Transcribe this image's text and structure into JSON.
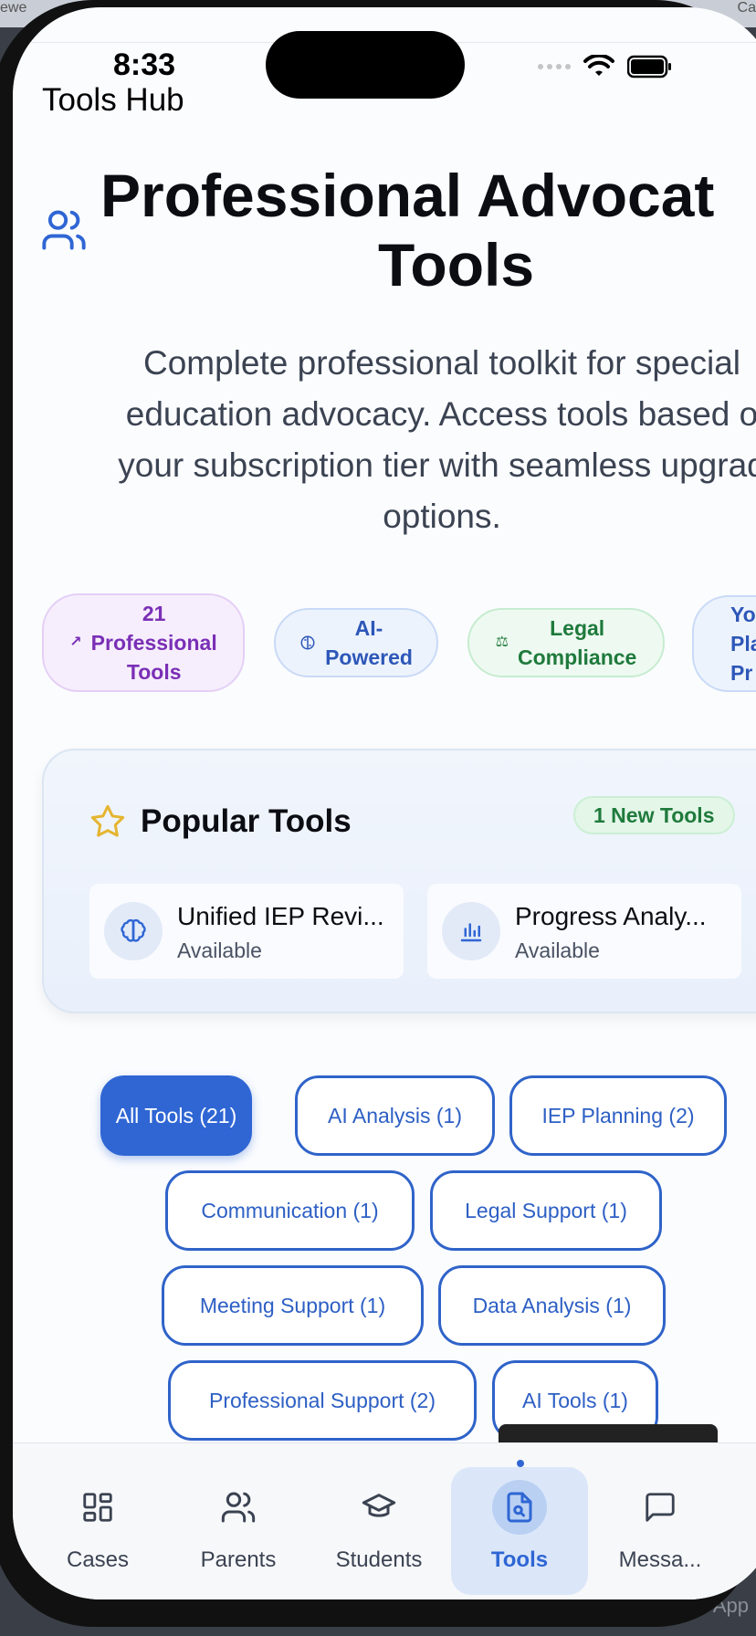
{
  "desktop": {
    "left_text": "ewe",
    "right_text": "Ca",
    "bottom_text": "App"
  },
  "status_bar": {
    "time": "8:33"
  },
  "app": {
    "title": "Tools Hub"
  },
  "hero": {
    "heading_line1": "Professional Advocat",
    "heading_line2": "Tools",
    "subtitle_lines": [
      "Complete professional toolkit for special",
      "education advocacy. Access tools based o",
      "your subscription tier with seamless upgrad",
      "options."
    ]
  },
  "badges": [
    {
      "lines": [
        "21",
        "Professional",
        "Tools"
      ],
      "icon": "trend-up-icon",
      "color": "#7a2fb6"
    },
    {
      "lines": [
        "AI-",
        "Powered"
      ],
      "icon": "brain-icon",
      "color": "#2d57b8"
    },
    {
      "lines": [
        "Legal",
        "Compliance"
      ],
      "icon": "scale-icon",
      "color": "#1f7a3c"
    },
    {
      "lines": [
        "You",
        "Pla",
        "Pr"
      ],
      "icon": "",
      "color": "#2d57b8"
    }
  ],
  "popular": {
    "title": "Popular Tools",
    "new_badge": "1 New Tools",
    "tools": [
      {
        "name": "Unified IEP Revi...",
        "status": "Available",
        "icon": "brain-icon"
      },
      {
        "name": "Progress Analy...",
        "status": "Available",
        "icon": "bar-chart-icon"
      }
    ]
  },
  "filters": [
    {
      "label": "All Tools (21)",
      "active": true
    },
    {
      "label": "AI Analysis (1)",
      "active": false
    },
    {
      "label": "IEP Planning (2)",
      "active": false
    },
    {
      "label": "Communication (1)",
      "active": false
    },
    {
      "label": "Legal Support (1)",
      "active": false
    },
    {
      "label": "Meeting Support (1)",
      "active": false
    },
    {
      "label": "Data Analysis (1)",
      "active": false
    },
    {
      "label": "Professional Support (2)",
      "active": false
    },
    {
      "label": "AI Tools (1)",
      "active": false
    }
  ],
  "tabbar": [
    {
      "label": "Cases",
      "icon": "grid-icon",
      "active": false
    },
    {
      "label": "Parents",
      "icon": "users-icon",
      "active": false
    },
    {
      "label": "Students",
      "icon": "graduation-cap-icon",
      "active": false
    },
    {
      "label": "Tools",
      "icon": "document-search-icon",
      "active": true
    },
    {
      "label": "Messa...",
      "icon": "message-icon",
      "active": false
    }
  ],
  "colors": {
    "accent": "#2f66d4",
    "heading": "#0b0d12",
    "body_text": "#3b4352"
  }
}
